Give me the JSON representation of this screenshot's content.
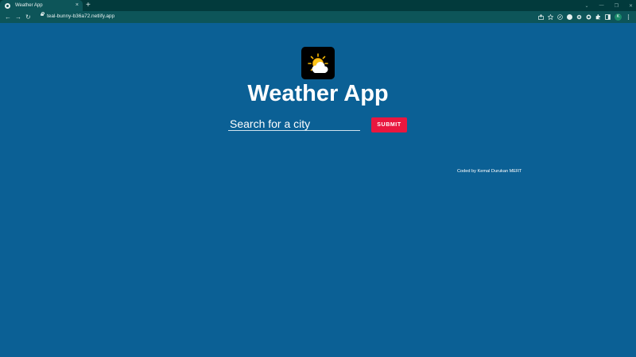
{
  "browser": {
    "tab": {
      "title": "Weather App",
      "close_label": "×"
    },
    "new_tab_label": "+",
    "window_controls": [
      "⌄",
      "—",
      "❐",
      "✕"
    ],
    "nav": {
      "back": "←",
      "forward": "→",
      "reload": "↻"
    },
    "url": "teal-bunny-b36a72.netlify.app",
    "toolbar_icons": [
      "share-icon",
      "bookmark-star-icon",
      "extension-compass-icon",
      "extension-face-icon",
      "extension-gear-icon",
      "extension-circle-icon",
      "extensions-puzzle-icon",
      "side-panel-icon",
      "profile-avatar",
      "menu-kebab-icon"
    ],
    "profile_initial": "K",
    "theme_colors": {
      "tabbar": "#023a3c",
      "toolbar": "#0d5559"
    }
  },
  "page": {
    "background": "#0b6095",
    "logo_icon": "sun-behind-cloud-icon",
    "title": "Weather App",
    "search": {
      "placeholder": "Search for a city",
      "value": ""
    },
    "submit_label": "SUBMIT",
    "submit_color": "#e9173f",
    "credit": "Coded by Kemal Durukan MERT"
  }
}
